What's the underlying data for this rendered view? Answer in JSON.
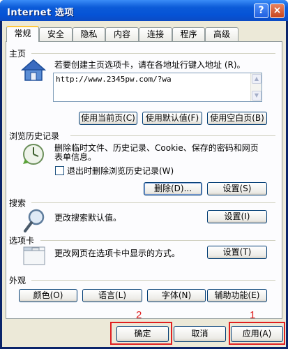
{
  "window": {
    "title": "Internet 选项",
    "help_label": "?",
    "close_label": "×"
  },
  "tabs": [
    "常规",
    "安全",
    "隐私",
    "内容",
    "连接",
    "程序",
    "高级"
  ],
  "homepage": {
    "group_label": "主页",
    "description": "若要创建主页选项卡，请在各地址行键入地址 (R)。",
    "url": "http://www.2345pw.com/?wa",
    "buttons": [
      "使用当前页(C)",
      "使用默认值(F)",
      "使用空白页(B)"
    ]
  },
  "history": {
    "group_label": "浏览历史记录",
    "description_line1": "删除临时文件、历史记录、Cookie、保存的密码和网页",
    "description_line2": "表单信息。",
    "checkbox_label": "退出时删除浏览历史记录(W)",
    "checkbox_checked": false,
    "delete_button": "删除(D)...",
    "settings_button": "设置(S)"
  },
  "search": {
    "group_label": "搜索",
    "description": "更改搜索默认值。",
    "settings_button": "设置(I)"
  },
  "tabs_group": {
    "group_label": "选项卡",
    "description": "更改网页在选项卡中显示的方式。",
    "settings_button": "设置(T)"
  },
  "appearance": {
    "group_label": "外观",
    "buttons": [
      "颜色(O)",
      "语言(L)",
      "字体(N)",
      "辅助功能(E)"
    ]
  },
  "footer": {
    "ok_button": "确定",
    "cancel_button": "取消",
    "apply_button": "应用(A)"
  },
  "annotations": {
    "marker_1": "1",
    "marker_2": "2",
    "color": "#e02020"
  },
  "colors": {
    "titlebar": "#0553d6",
    "dialog_bg": "#ece9d8",
    "active_tab_highlight": "#ffc83c"
  }
}
